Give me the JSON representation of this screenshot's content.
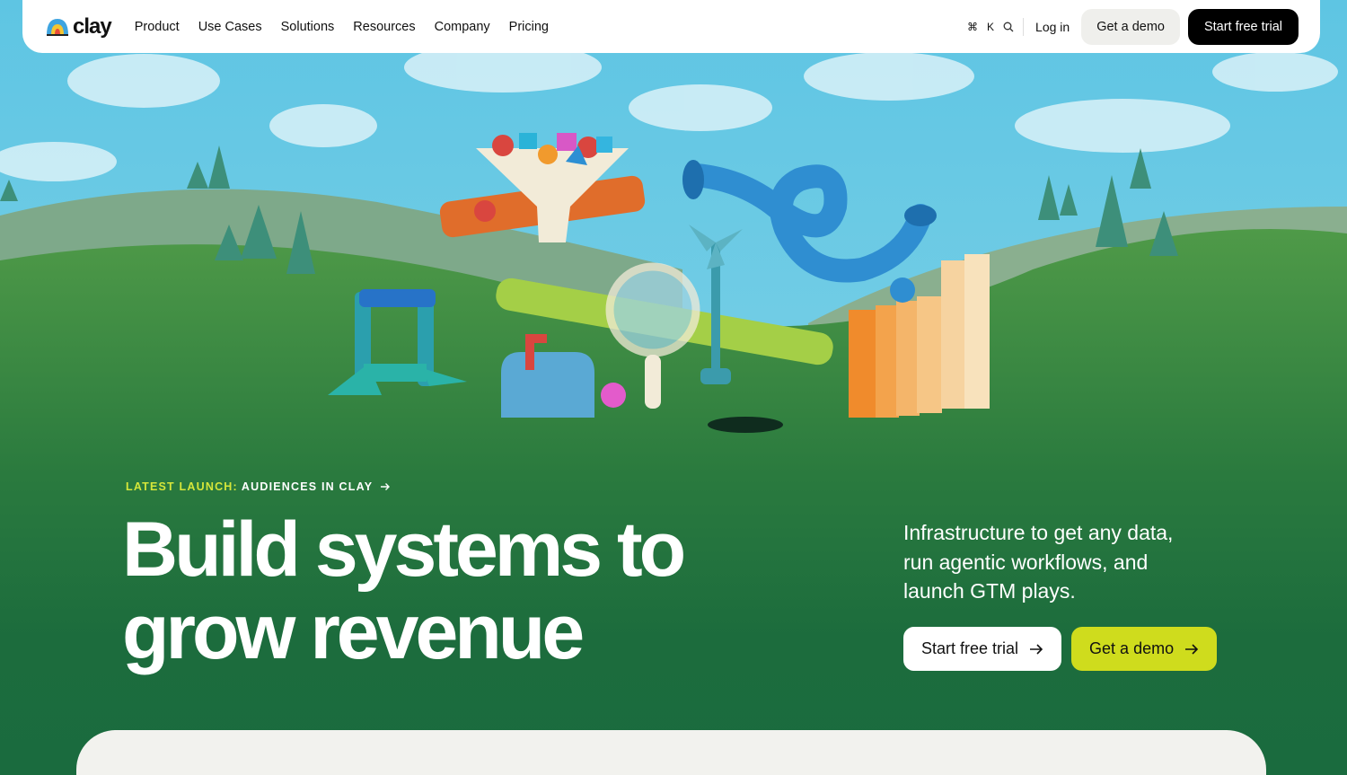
{
  "nav": {
    "logo_text": "clay",
    "links": [
      "Product",
      "Use Cases",
      "Solutions",
      "Resources",
      "Company",
      "Pricing"
    ],
    "shortcut_cmd": "⌘",
    "shortcut_key": "K",
    "login": "Log in",
    "demo": "Get a demo",
    "trial": "Start free trial"
  },
  "hero": {
    "launch_label": "LATEST LAUNCH:",
    "launch_text": "AUDIENCES IN CLAY",
    "headline_line1": "Build systems to",
    "headline_line2": "grow revenue",
    "subtext": "Infrastructure to get any data, run agentic workflows, and launch GTM plays.",
    "cta_trial": "Start free trial",
    "cta_demo": "Get a demo"
  },
  "colors": {
    "accent_yellow": "#cfdc1d",
    "launch_label": "#d5e63a",
    "hero_green": "#1a6b3e"
  }
}
